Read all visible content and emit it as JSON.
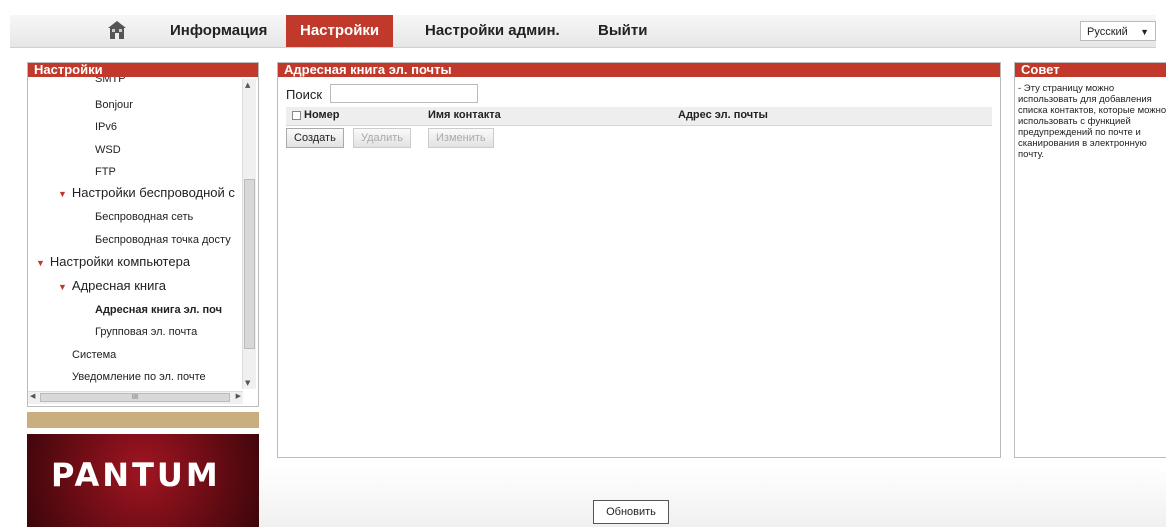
{
  "nav": {
    "items": [
      {
        "label": "Информация"
      },
      {
        "label": "Настройки"
      },
      {
        "label": "Настройки админ."
      },
      {
        "label": "Выйти"
      }
    ],
    "active_index": 1,
    "language": "Русский"
  },
  "sidebar": {
    "title": "Настройки",
    "tree": [
      {
        "label": "SMTP"
      },
      {
        "label": "Bonjour"
      },
      {
        "label": "IPv6"
      },
      {
        "label": "WSD"
      },
      {
        "label": "FTP"
      },
      {
        "label": "Настройки беспроводной с"
      },
      {
        "label": "Беспроводная сеть"
      },
      {
        "label": "Беспроводная точка досту"
      },
      {
        "label": "Настройки компьютера"
      },
      {
        "label": "Адресная книга"
      },
      {
        "label": "Адресная книга эл. поч"
      },
      {
        "label": "Групповая эл. почта"
      },
      {
        "label": "Система"
      },
      {
        "label": "Уведомление по эл. почте"
      }
    ],
    "hscroll_glyph": "III"
  },
  "logo": {
    "text": "PANTUM"
  },
  "main": {
    "title": "Адресная книга эл. почты",
    "search_label": "Поиск",
    "search_value": "",
    "columns": [
      "Номер",
      "Имя контакта",
      "Адрес эл. почты"
    ],
    "buttons": {
      "create": "Создать",
      "delete": "Удалить",
      "edit": "Изменить"
    }
  },
  "tip": {
    "title": "Совет",
    "text": "- Эту страницу можно использовать для добавления списка контактов, которые можно использовать с функцией предупреждений по почте и сканирования в электронную почту."
  },
  "footer": {
    "refresh_label": "Обновить"
  },
  "colors": {
    "accent": "#c0392b",
    "tan": "#c9ae7e"
  }
}
